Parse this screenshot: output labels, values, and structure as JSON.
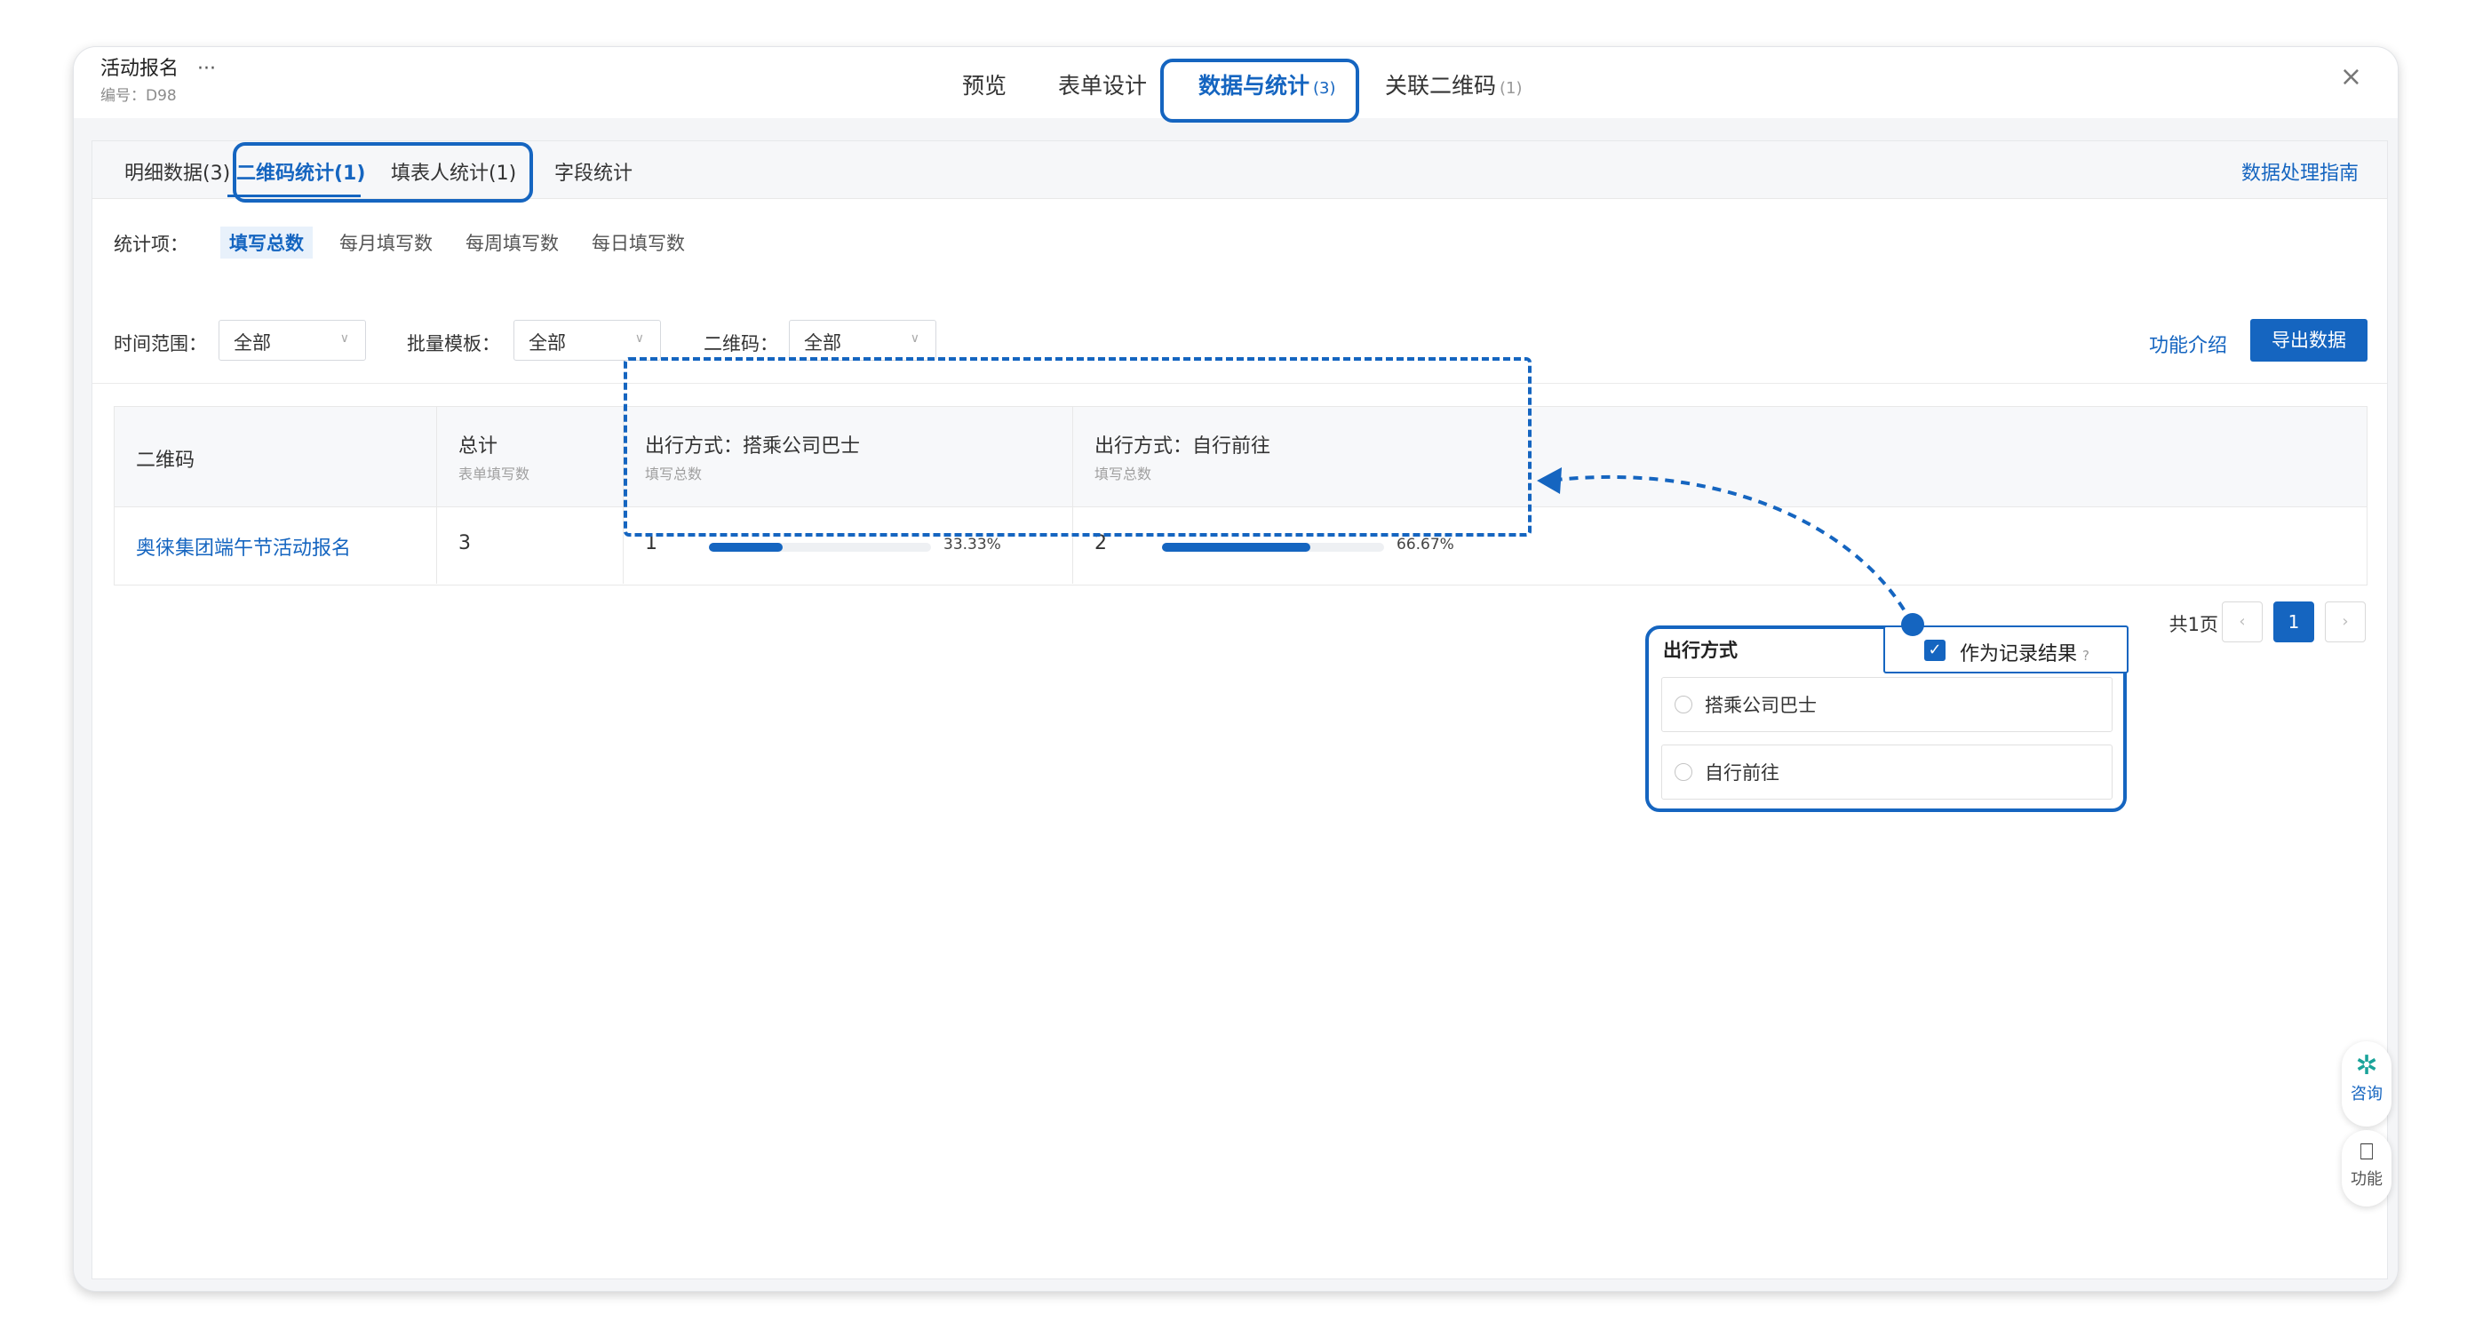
{
  "header": {
    "title": "活动报名",
    "more": "···",
    "code": "编号：D98",
    "tabs": [
      {
        "label": "预览",
        "count": ""
      },
      {
        "label": "表单设计",
        "count": ""
      },
      {
        "label": "数据与统计",
        "count": "(3)"
      },
      {
        "label": "关联二维码",
        "count": "(1)"
      }
    ],
    "close": "×"
  },
  "subtabs": {
    "items": [
      "明细数据(3)",
      "二维码统计(1)",
      "填表人统计(1)",
      "字段统计"
    ],
    "guide_link": "数据处理指南"
  },
  "filters": {
    "stat_label": "统计项：",
    "stat_items": [
      "填写总数",
      "每月填写数",
      "每周填写数",
      "每日填写数"
    ],
    "time_label": "时间范围：",
    "time_value": "全部",
    "template_label": "批量模板：",
    "template_value": "全部",
    "qr_label": "二维码：",
    "qr_value": "全部",
    "intro_link": "功能介绍",
    "export_button": "导出数据"
  },
  "table": {
    "columns": [
      {
        "title": "二维码",
        "sub": ""
      },
      {
        "title": "总计",
        "sub": "表单填写数"
      },
      {
        "title": "出行方式：搭乘公司巴士",
        "sub": "填写总数"
      },
      {
        "title": "出行方式：自行前往",
        "sub": "填写总数"
      }
    ],
    "rows": [
      {
        "qr_name": "奥徕集团端午节活动报名",
        "total": "3",
        "bus_count": "1",
        "bus_pct_label": "33.33%",
        "bus_fraction": 0.3333,
        "self_count": "2",
        "self_pct_label": "66.67%",
        "self_fraction": 0.6667
      }
    ]
  },
  "pagination": {
    "label": "共1页",
    "prev": "‹",
    "current": "1",
    "next": "›"
  },
  "callout": {
    "title": "出行方式",
    "record_label": "作为记录结果",
    "record_checked": true,
    "help": "?",
    "options": [
      "搭乘公司巴士",
      "自行前往"
    ]
  },
  "side": {
    "consult_label": "咨询",
    "consult_icon": "sparkle-icon",
    "feature_label": "功能",
    "feature_icon": "bookmark-icon"
  },
  "colors": {
    "accent": "#1565c0",
    "track": "#eef0f3"
  }
}
